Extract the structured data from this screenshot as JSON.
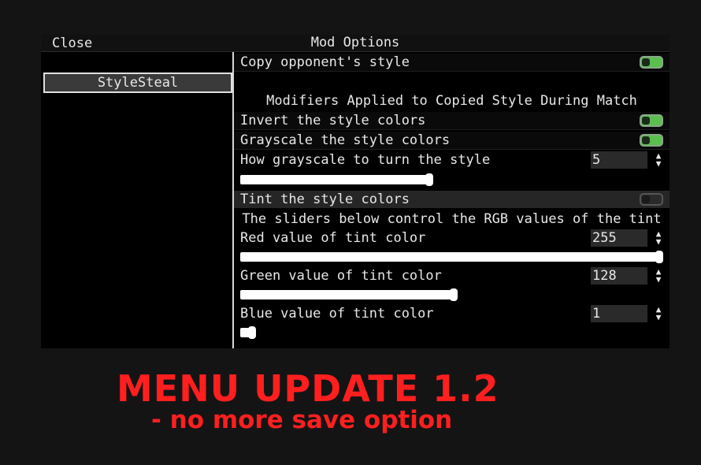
{
  "topbar": {
    "close_label": "Close",
    "title": "Mod Options"
  },
  "sidebar": {
    "items": [
      {
        "label": "StyleSteal"
      }
    ]
  },
  "options": {
    "copy_style": {
      "label": "Copy opponent's style",
      "enabled": true
    },
    "modifiers_header": "Modifiers Applied to Copied Style During Match",
    "invert": {
      "label": "Invert the style colors",
      "enabled": true
    },
    "grayscale": {
      "label": "Grayscale the style colors",
      "enabled": true
    },
    "grayscale_amount": {
      "label": "How grayscale to turn the style",
      "value": "5",
      "fraction": 0.45
    },
    "tint": {
      "label": "Tint the style colors",
      "enabled": false
    },
    "tint_header": "The sliders below control the RGB values of the tint",
    "red": {
      "label": "Red value of tint color",
      "value": "255",
      "fraction": 1.0
    },
    "green": {
      "label": "Green value of tint color",
      "value": "128",
      "fraction": 0.5
    },
    "blue": {
      "label": "Blue value of tint color",
      "value": "1",
      "fraction": 0.004
    }
  },
  "banner": {
    "title": "MENU UPDATE 1.2",
    "subtitle": "- no more save option"
  },
  "colors": {
    "toggle_on": "#5bbf4e",
    "banner_red": "#ff1f1f"
  }
}
